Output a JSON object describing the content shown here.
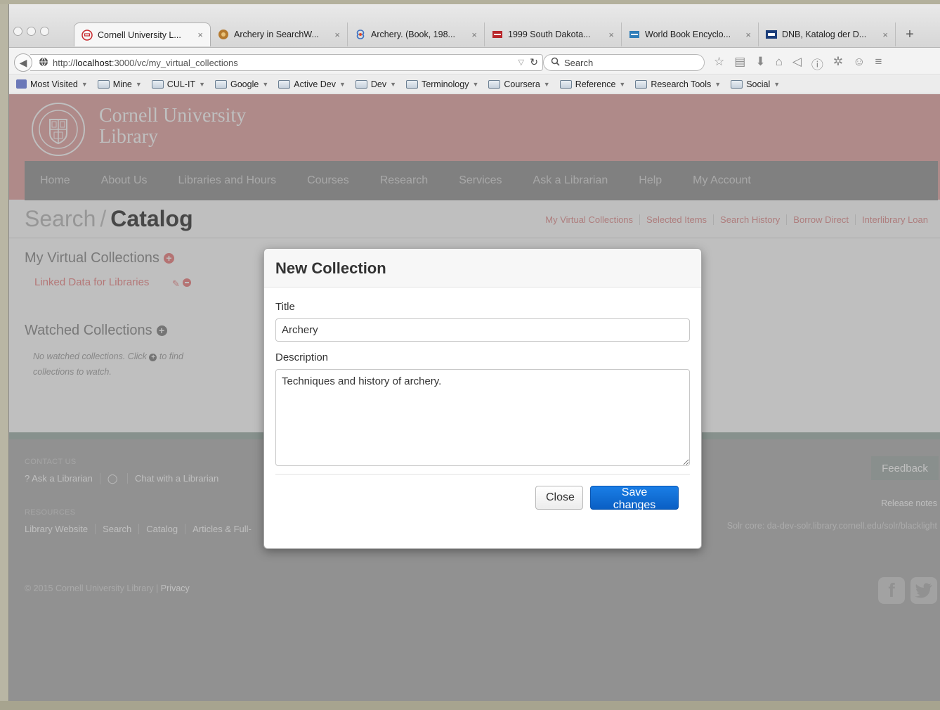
{
  "browser": {
    "tabs": [
      {
        "title": "Cornell University L...",
        "active": true
      },
      {
        "title": "Archery in SearchW...",
        "active": false
      },
      {
        "title": "Archery. (Book, 198...",
        "active": false
      },
      {
        "title": "1999 South Dakota...",
        "active": false
      },
      {
        "title": "World Book Encyclo...",
        "active": false
      },
      {
        "title": "DNB, Katalog der D...",
        "active": false
      }
    ],
    "new_tab": "+",
    "close_glyph": "×",
    "url_prefix": "http://",
    "url_host": "localhost",
    "url_rest": ":3000/vc/my_virtual_collections",
    "search_placeholder": "Search",
    "bookmarks": [
      "Most Visited",
      "Mine",
      "CUL-IT",
      "Google",
      "Active Dev",
      "Dev",
      "Terminology",
      "Coursera",
      "Reference",
      "Research Tools",
      "Social"
    ]
  },
  "library": {
    "name_line1": "Cornell University",
    "name_line2": "Library",
    "nav": [
      "Home",
      "About Us",
      "Libraries and Hours",
      "Courses",
      "Research",
      "Services",
      "Ask a Librarian",
      "Help",
      "My Account"
    ],
    "title_search": "Search",
    "title_sep": "/",
    "title_catalog": "Catalog",
    "top_links": [
      "My Virtual Collections",
      "Selected Items",
      "Search History",
      "Borrow Direct",
      "Interlibrary Loan"
    ]
  },
  "sidebar": {
    "my_collections": "My Virtual Collections",
    "collection": "Linked Data for Libraries",
    "watched": "Watched Collections",
    "no_watched_1": "No watched collections. Click",
    "no_watched_2": "to find collections to watch."
  },
  "footer": {
    "contact_label": "Contact Us",
    "contact_links": [
      "? Ask a Librarian",
      "Chat with a Librarian"
    ],
    "resources_label": "Resources",
    "resources_links": [
      "Library Website",
      "Search",
      "Catalog",
      "Articles & Full-"
    ],
    "copyright": "© 2015 Cornell University Library |",
    "privacy": "Privacy",
    "feedback": "Feedback",
    "release_notes": "Release notes",
    "solr": "Solr core: da-dev-solr.library.cornell.edu/solr/blacklight"
  },
  "modal": {
    "title": "New Collection",
    "title_label": "Title",
    "title_value": "Archery",
    "description_label": "Description",
    "description_value": "Techniques and history of archery.",
    "close_label": "Close",
    "save_label": "Save changes"
  },
  "colors": {
    "header_pink": "#eab8b7",
    "link_pink": "#f0a0a0",
    "save_blue": "#0a5fc4",
    "backdrop": "rgba(0,0,0,0.25)"
  }
}
